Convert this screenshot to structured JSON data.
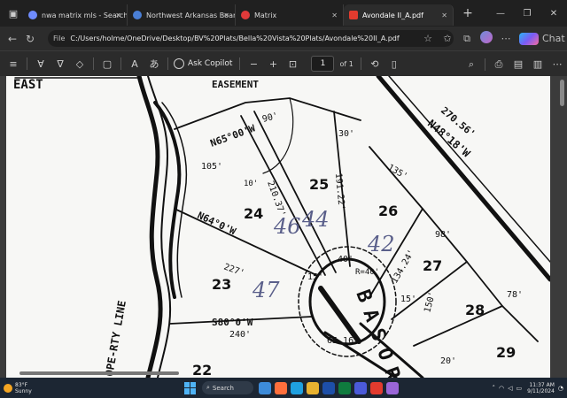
{
  "browser": {
    "tabs": [
      {
        "title": "nwa matrix mls - Search",
        "favicon_color": "#6f8cff",
        "active": false
      },
      {
        "title": "Northwest Arkansas Board of",
        "favicon_color": "#4a7fd6",
        "active": false
      },
      {
        "title": "Matrix",
        "favicon_color": "#e03a3a",
        "active": false
      },
      {
        "title": "Avondale II_A.pdf",
        "favicon_color": "#e23b2e",
        "active": true
      }
    ],
    "address": {
      "prefix": "File",
      "url": "C:/Users/holme/OneDrive/Desktop/BV%20Plats/Bella%20Vista%20Plats/Avondale%20II_A.pdf"
    },
    "chat_label": "Chat"
  },
  "pdf_toolbar": {
    "ask_copilot": "Ask Copilot",
    "page_current": "1",
    "page_total": "of 1"
  },
  "plat": {
    "labels": {
      "east": "EAST",
      "easement": "EASEMENT",
      "property_line": "OPE-RTY LINE",
      "bearing_top": "N65°00'W",
      "bearing_mid": "N64°0'W",
      "bearing_low": "S80°0'W",
      "bearing_right": "N48°18'W",
      "dist_270": "270.56'",
      "dist_105": "105'",
      "dist_90": "90'",
      "dist_40": "40'",
      "dist_30": "30'",
      "dist_135": "135'",
      "dist_227": "227'",
      "dist_240": "240'",
      "dist_210": "210.37'",
      "dist_191": "191.22'",
      "dist_134": "134.24'",
      "dist_98": "98'",
      "dist_150": "150'",
      "dist_65": "65.16'",
      "dist_15a": "15'",
      "dist_15b": "15'",
      "dist_20": "20'",
      "dist_78": "78'",
      "dist_10": "10'",
      "radius_note": "R=40'",
      "rd_name": "BASOR"
    },
    "lots": [
      "22",
      "23",
      "24",
      "25",
      "26",
      "27",
      "28",
      "29"
    ],
    "handwritten": [
      "47",
      "46",
      "44",
      "42"
    ]
  },
  "taskbar": {
    "weather_temp": "83°F",
    "weather_desc": "Sunny",
    "search_label": "Search",
    "time": "11:37 AM",
    "date": "9/11/2024"
  },
  "colors": {
    "handwriting": "#5a5f8a",
    "accent": "#4fb3f5"
  }
}
